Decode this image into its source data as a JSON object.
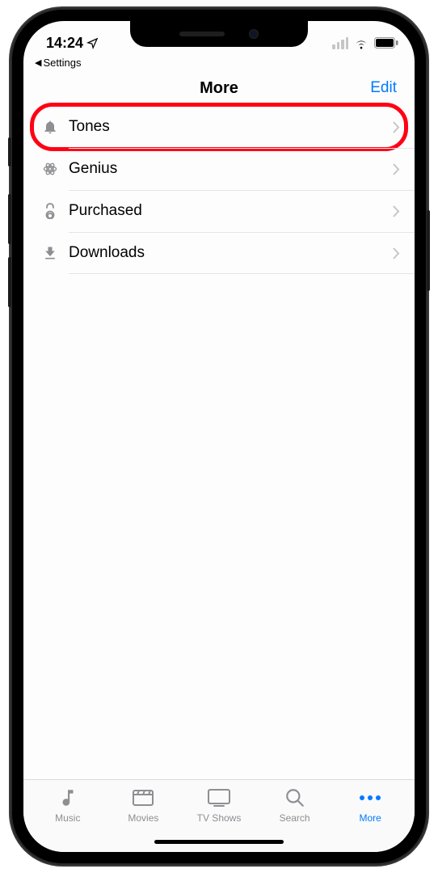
{
  "status": {
    "time": "14:24",
    "back_label": "Settings"
  },
  "header": {
    "title": "More",
    "edit": "Edit"
  },
  "rows": [
    {
      "label": "Tones"
    },
    {
      "label": "Genius"
    },
    {
      "label": "Purchased"
    },
    {
      "label": "Downloads"
    }
  ],
  "tabs": {
    "music": "Music",
    "movies": "Movies",
    "tvshows": "TV Shows",
    "search": "Search",
    "more": "More"
  }
}
